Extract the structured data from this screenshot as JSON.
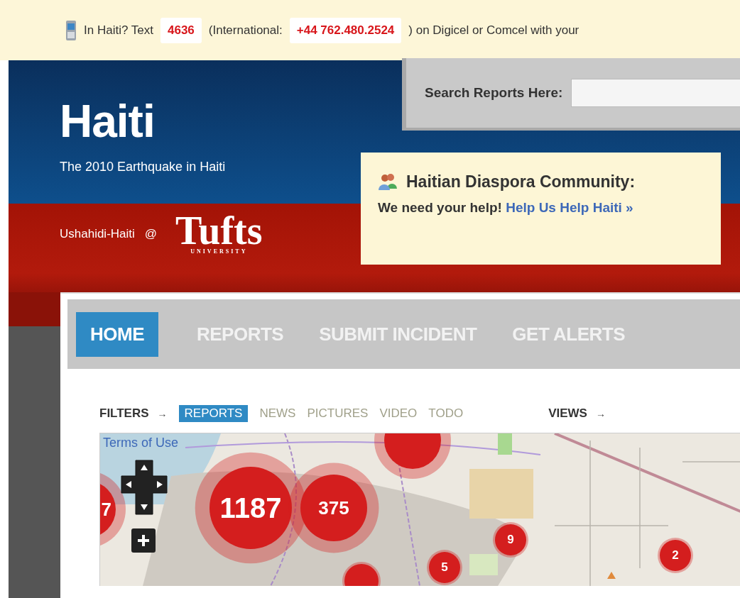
{
  "alert_bar": {
    "parts": [
      {
        "kind": "text",
        "text": "In Haiti? Text"
      },
      {
        "kind": "code",
        "text": "4636"
      },
      {
        "kind": "text",
        "text": "(International:"
      },
      {
        "kind": "code",
        "text": "+44 762.480.2524"
      },
      {
        "kind": "text",
        "text": ")  on Digicel or Comcel with your"
      }
    ]
  },
  "site": {
    "title": "Haiti",
    "subtitle": "The 2010 Earthquake in Haiti",
    "partner": "Ushahidi-Haiti",
    "at": "@",
    "logo": "Tufts",
    "logo_sub": "UNIVERSITY"
  },
  "search": {
    "label": "Search Reports Here:"
  },
  "callout": {
    "title": "Haitian Diaspora Community:",
    "text": "We need your help!",
    "link": "Help Us Help Haiti »"
  },
  "nav": [
    {
      "label": "HOME",
      "selected": true
    },
    {
      "label": "REPORTS",
      "selected": false
    },
    {
      "label": "SUBMIT INCIDENT",
      "selected": false
    },
    {
      "label": "GET ALERTS",
      "selected": false
    }
  ],
  "filters": {
    "label": "FILTERS",
    "arrow": "→",
    "items": [
      {
        "label": "REPORTS",
        "selected": true
      },
      {
        "label": "NEWS",
        "selected": false
      },
      {
        "label": "PICTURES",
        "selected": false
      },
      {
        "label": "VIDEO",
        "selected": false
      },
      {
        "label": "TODO",
        "selected": false
      }
    ],
    "views_label": "VIEWS",
    "views_arrow": "→"
  },
  "map": {
    "terms": "Terms of Use",
    "clusters": [
      {
        "kind": "medium"
      },
      {
        "count": "7",
        "kind": "edge"
      },
      {
        "count": "1187",
        "kind": "large"
      },
      {
        "count": "375",
        "kind": "medium"
      },
      {
        "count": "9",
        "kind": "small"
      },
      {
        "count": "2",
        "kind": "small"
      },
      {
        "count": "5",
        "kind": "small"
      },
      {
        "kind": "small"
      }
    ]
  }
}
